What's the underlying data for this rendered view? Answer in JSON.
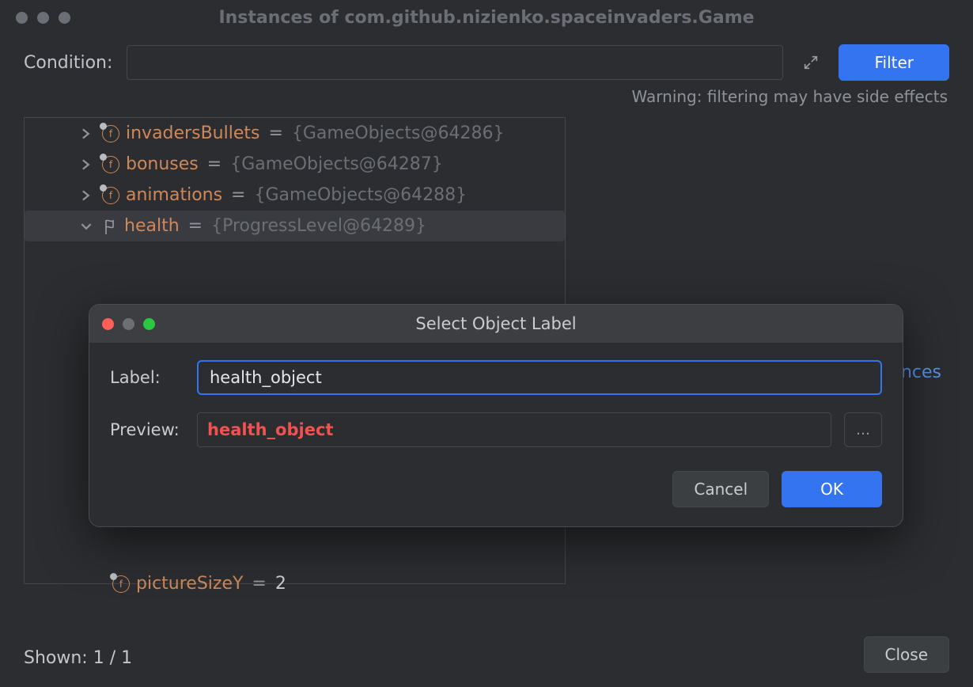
{
  "window": {
    "title": "Instances of com.github.nizienko.spaceinvaders.Game"
  },
  "condition": {
    "label": "Condition:",
    "value": "",
    "warning": "Warning: filtering may have side effects",
    "filter_label": "Filter"
  },
  "tree": {
    "rows": [
      {
        "expander": "chev-right",
        "icon": "field",
        "name": "invadersBullets",
        "value": "{GameObjects@64286}"
      },
      {
        "expander": "chev-right",
        "icon": "field",
        "name": "bonuses",
        "value": "{GameObjects@64287}"
      },
      {
        "expander": "chev-right",
        "icon": "field",
        "name": "animations",
        "value": "{GameObjects@64288}"
      },
      {
        "expander": "chev-down",
        "icon": "flag",
        "name": "health",
        "value": "{ProgressLevel@64289}",
        "selected": true
      }
    ],
    "trailing_row": {
      "icon": "field",
      "name": "pictureSizeY",
      "value": "2"
    },
    "peek_link_suffix": "nces"
  },
  "status": {
    "shown_label": "Shown: 1 / 1",
    "close_label": "Close"
  },
  "modal": {
    "title": "Select Object Label",
    "label_field_label": "Label:",
    "label_value": "health_object",
    "preview_label": "Preview:",
    "preview_value": "health_object",
    "more_label": "...",
    "cancel_label": "Cancel",
    "ok_label": "OK"
  }
}
